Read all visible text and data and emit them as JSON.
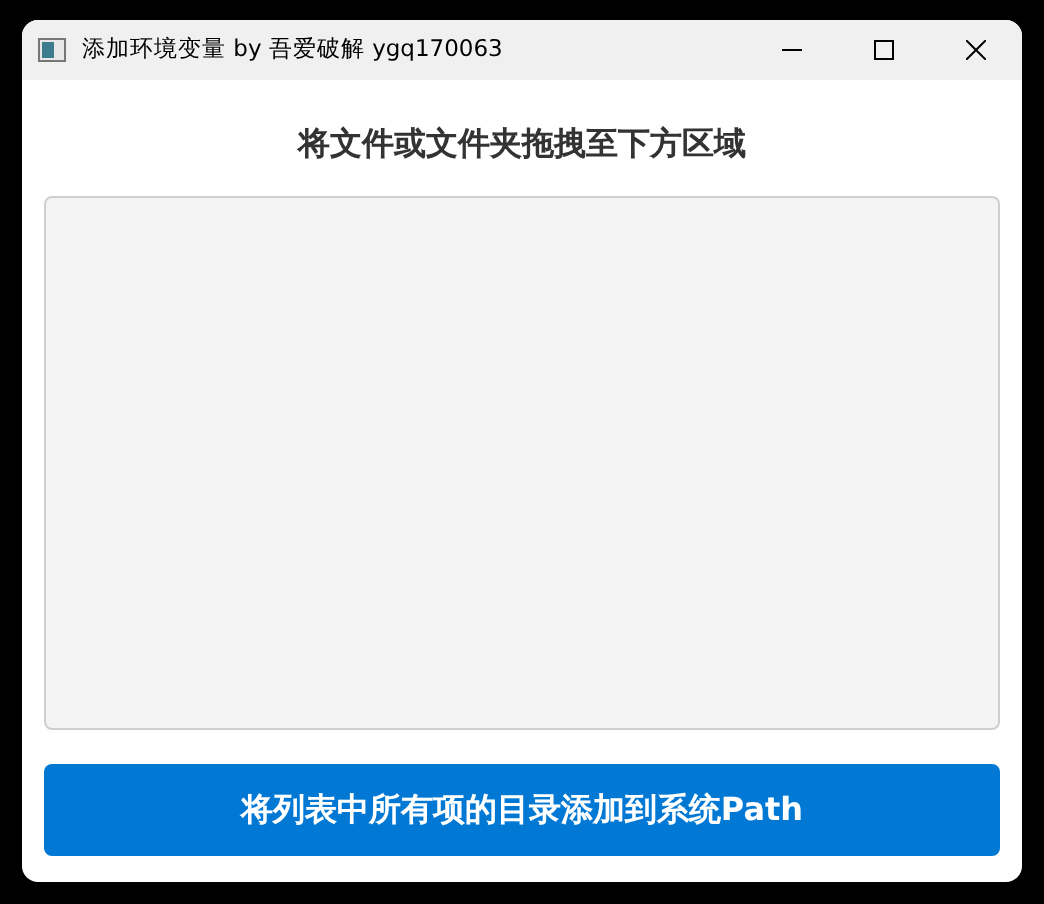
{
  "window": {
    "title": "添加环境变量 by 吾爱破解 ygq170063"
  },
  "heading": "将文件或文件夹拖拽至下方区域",
  "button": {
    "label": "将列表中所有项的目录添加到系统Path"
  }
}
